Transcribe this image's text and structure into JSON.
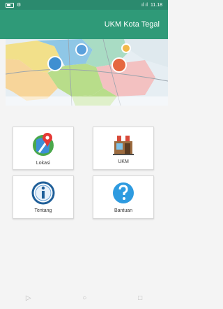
{
  "status": {
    "time": "11.18",
    "signal_text": "ıl ıl"
  },
  "appbar": {
    "title": "UKM Kota Tegal"
  },
  "menu": {
    "items": [
      {
        "label": "Lokasi"
      },
      {
        "label": "UKM"
      },
      {
        "label": "Tentang"
      },
      {
        "label": "Bantuan"
      }
    ]
  },
  "colors": {
    "primary": "#2f9a78",
    "statusbar": "#2b8a6e"
  }
}
